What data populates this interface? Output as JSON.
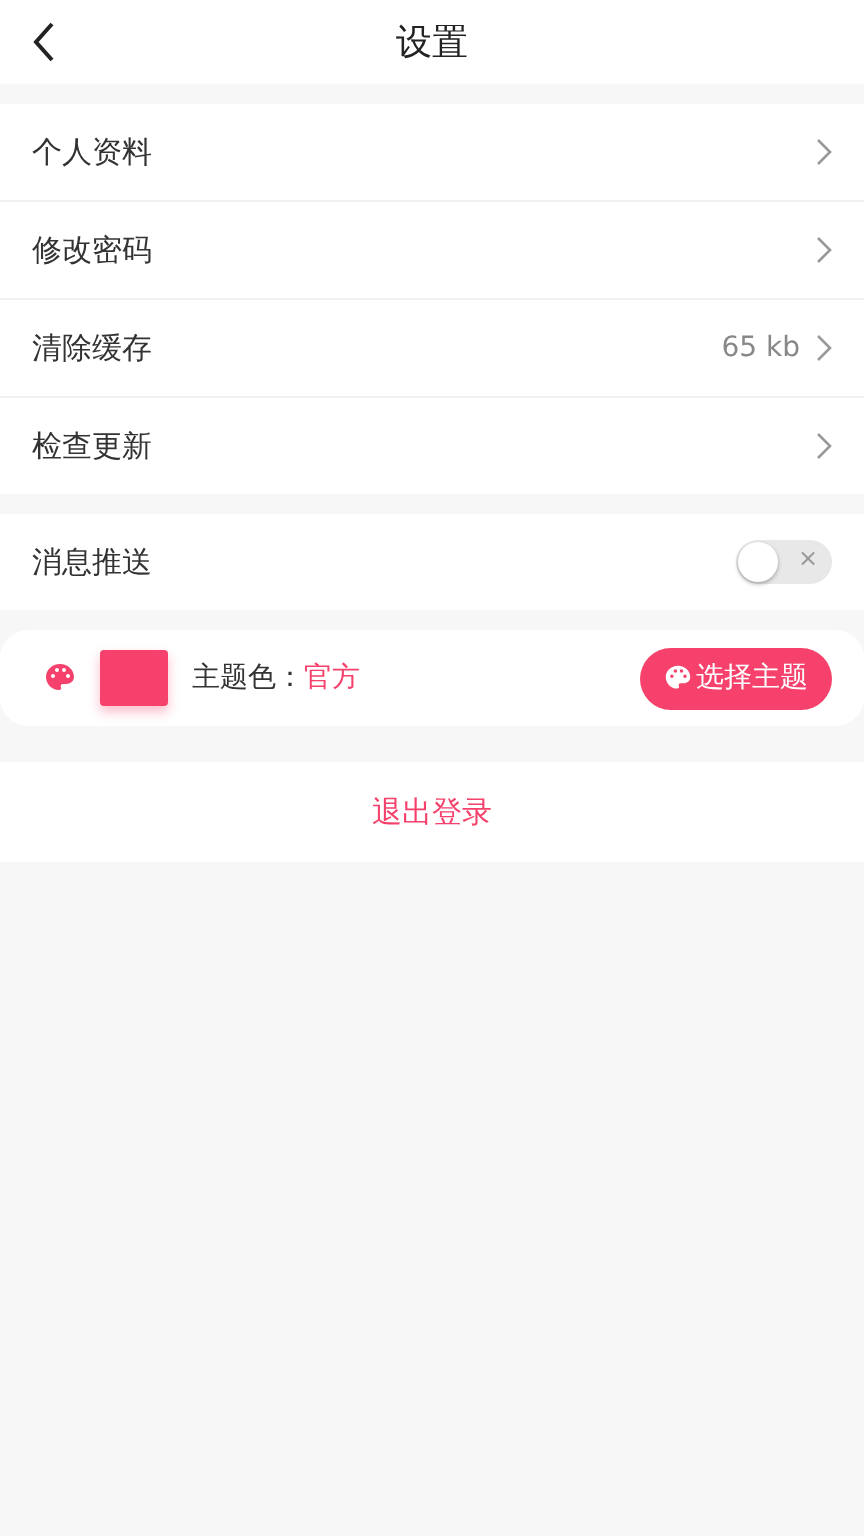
{
  "header": {
    "title": "设置"
  },
  "menu_items": [
    {
      "label": "个人资料"
    },
    {
      "label": "修改密码"
    },
    {
      "label": "清除缓存",
      "value": "65 kb"
    },
    {
      "label": "检查更新"
    }
  ],
  "push": {
    "label": "消息推送",
    "on": false,
    "off_mark": "×"
  },
  "theme": {
    "label": "主题色：",
    "name": "官方",
    "color": "#f5416b",
    "button": "选择主题"
  },
  "logout": "退出登录"
}
